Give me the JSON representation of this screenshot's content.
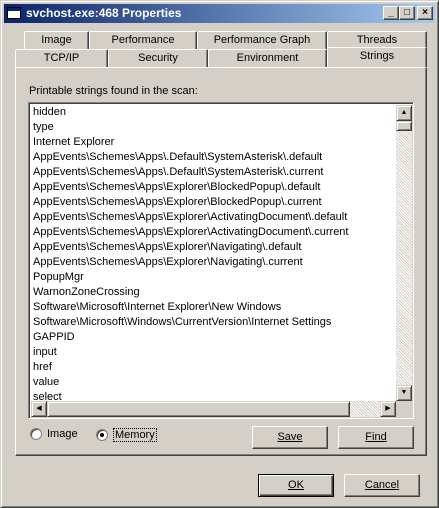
{
  "window": {
    "title": "svchost.exe:468 Properties"
  },
  "titlebar_buttons": {
    "minimize": "_",
    "maximize": "□",
    "close": "×"
  },
  "tabs_row1": [
    {
      "label": "Image"
    },
    {
      "label": "Performance"
    },
    {
      "label": "Performance Graph"
    },
    {
      "label": "Threads"
    }
  ],
  "tabs_row2": [
    {
      "label": "TCP/IP"
    },
    {
      "label": "Security"
    },
    {
      "label": "Environment"
    },
    {
      "label": "Strings",
      "active": true
    }
  ],
  "strings_panel": {
    "caption": "Printable strings found in the scan:",
    "lines": [
      "hidden",
      "type",
      "Internet Explorer",
      "AppEvents\\Schemes\\Apps\\.Default\\SystemAsterisk\\.default",
      "AppEvents\\Schemes\\Apps\\.Default\\SystemAsterisk\\.current",
      "AppEvents\\Schemes\\Apps\\Explorer\\BlockedPopup\\.default",
      "AppEvents\\Schemes\\Apps\\Explorer\\BlockedPopup\\.current",
      "AppEvents\\Schemes\\Apps\\Explorer\\ActivatingDocument\\.default",
      "AppEvents\\Schemes\\Apps\\Explorer\\ActivatingDocument\\.current",
      "AppEvents\\Schemes\\Apps\\Explorer\\Navigating\\.default",
      "AppEvents\\Schemes\\Apps\\Explorer\\Navigating\\.current",
      "PopupMgr",
      "WarnonZoneCrossing",
      "Software\\Microsoft\\Internet Explorer\\New Windows",
      "Software\\Microsoft\\Windows\\CurrentVersion\\Internet Settings",
      "GAPPID",
      "input",
      "href",
      "value",
      "select"
    ],
    "radio_image": "Image",
    "radio_memory": "Memory",
    "selected_source": "Memory",
    "save_label": "Save",
    "find_label": "Find"
  },
  "dialog_buttons": {
    "ok": "OK",
    "cancel": "Cancel"
  },
  "icons": {
    "scroll_up": "up-arrow-icon",
    "scroll_down": "down-arrow-icon",
    "scroll_left": "left-arrow-icon",
    "scroll_right": "right-arrow-icon"
  }
}
